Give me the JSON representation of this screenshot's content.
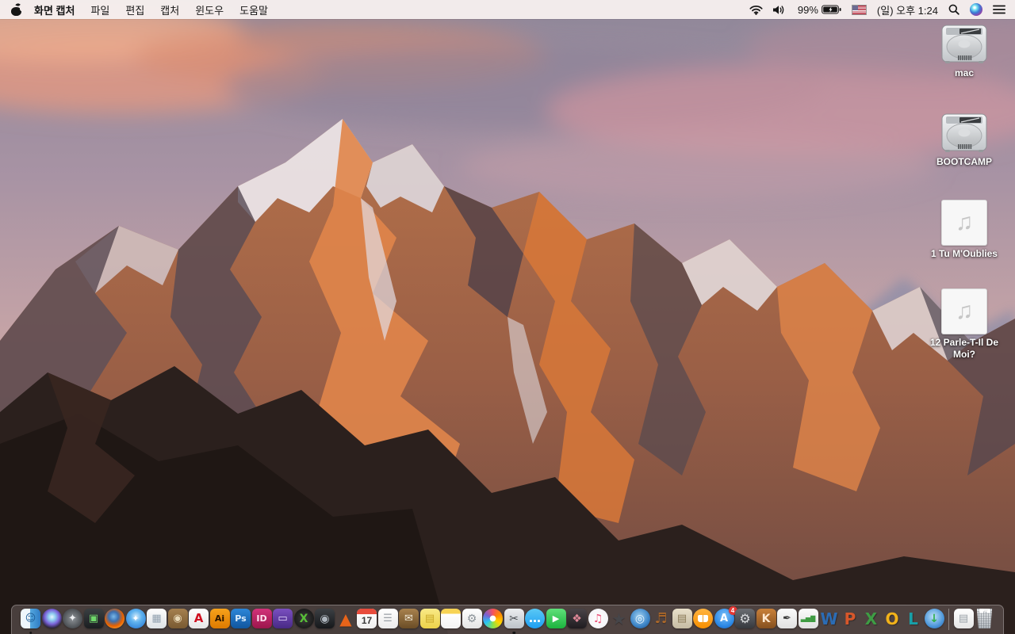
{
  "menu_bar": {
    "app_name": "화면 캡처",
    "menus": [
      "파일",
      "편집",
      "캡처",
      "윈도우",
      "도움말"
    ],
    "battery_percent": "99%",
    "battery_state": "charging",
    "clock": "(일) 오후 1:24",
    "status_icons": [
      "wifi-icon",
      "volume-icon",
      "battery-icon",
      "us-flag-input-source",
      "spotlight-icon",
      "siri-icon",
      "notification-center-icon"
    ]
  },
  "desktop": {
    "icons": [
      {
        "label": "mac",
        "type": "hard-drive"
      },
      {
        "label": "BOOTCAMP",
        "type": "hard-drive"
      },
      {
        "label": "1 Tu M'Oublies",
        "type": "audio-file"
      },
      {
        "label": "12 Parle-T-Il De Moi?",
        "type": "audio-file"
      }
    ]
  },
  "dock": {
    "apps": [
      {
        "name": "finder",
        "glyph": "☺",
        "bg": "linear-gradient(90deg,#eef6fc 0%,#eef6fc 48%,#54a8e0 48%,#2f7cc4 100%)",
        "fg": "#1d5c96",
        "shape": "square",
        "running": true
      },
      {
        "name": "siri",
        "glyph": "",
        "bg": "radial-gradient(circle at 50% 42%,#e8f4ff 0%,#8fd0f0 22%,#7a62d8 48%,#2a2438 74%,#121018 100%)",
        "fg": "#ffffff",
        "shape": "circle"
      },
      {
        "name": "launchpad",
        "glyph": "✦",
        "bg": "radial-gradient(circle,#8f9499 0%,#4a4e52 70%,#2e3134 100%)",
        "fg": "#eceef0",
        "shape": "circle"
      },
      {
        "name": "display-utility",
        "glyph": "▣",
        "bg": "linear-gradient(180deg,#3a3f42,#1b1e21)",
        "fg": "#6fd86a",
        "shape": "square"
      },
      {
        "name": "firefox",
        "glyph": "",
        "bg": "radial-gradient(circle at 45% 40%,#7ab8e8 0%,#3b6fb0 30%,#e66000 58%,#f79b2e 82%,#c84a00 100%)",
        "fg": "#ffffff",
        "shape": "circle"
      },
      {
        "name": "safari",
        "glyph": "✦",
        "bg": "radial-gradient(circle at 50% 40%,#cfe9fa 0%,#5fb2ee 38%,#1e6fd0 100%)",
        "fg": "#ffffff",
        "shape": "circle",
        "fs": 11
      },
      {
        "name": "preview",
        "glyph": "▦",
        "bg": "linear-gradient(180deg,#fdfdfd,#dde2e6)",
        "fg": "#93a2b0",
        "shape": "square"
      },
      {
        "name": "contacts",
        "glyph": "◉",
        "bg": "linear-gradient(180deg,#a5804f,#795a32)",
        "fg": "#e8d9b8",
        "shape": "square"
      },
      {
        "name": "acrobat-reader",
        "glyph": "A",
        "bg": "linear-gradient(180deg,#ffffff,#e6e6e6)",
        "fg": "#cf1020",
        "shape": "square",
        "fs": 15
      },
      {
        "name": "illustrator",
        "glyph": "Ai",
        "bg": "linear-gradient(180deg,#f7a21b,#dd7a00)",
        "fg": "#2a1500",
        "shape": "square",
        "fs": 11
      },
      {
        "name": "photoshop",
        "glyph": "Ps",
        "bg": "linear-gradient(180deg,#2c86d8,#11569e)",
        "fg": "#dff0ff",
        "shape": "square",
        "fs": 11
      },
      {
        "name": "indesign",
        "glyph": "ID",
        "bg": "linear-gradient(180deg,#d2327a,#9c164c)",
        "fg": "#ffe2f0",
        "shape": "square",
        "fs": 11
      },
      {
        "name": "toast-titanium",
        "glyph": "▭",
        "bg": "linear-gradient(180deg,#7a4fc0,#482a85)",
        "fg": "#e6d8ff",
        "shape": "square"
      },
      {
        "name": "video-converter",
        "glyph": "X",
        "bg": "radial-gradient(circle,#3c3c3c 0%,#0e0e0e 100%)",
        "fg": "#58c038",
        "shape": "circle",
        "fs": 14
      },
      {
        "name": "disk-drive-utility",
        "glyph": "◉",
        "bg": "linear-gradient(180deg,#3c4044,#16181b)",
        "fg": "#aeb6be",
        "shape": "square",
        "fs": 14
      },
      {
        "name": "vlc",
        "glyph": "▲",
        "bg": "transparent",
        "fg": "#e8641a",
        "shape": "plain"
      },
      {
        "name": "calendar",
        "bg": "linear-gradient(180deg,#ffffff,#efefef)",
        "shape": "calendar",
        "day": "17"
      },
      {
        "name": "reminders",
        "glyph": "☰",
        "bg": "linear-gradient(180deg,#ffffff,#ebebeb)",
        "fg": "#9aa0a6",
        "shape": "square"
      },
      {
        "name": "wooden-crate-mail",
        "glyph": "✉",
        "bg": "linear-gradient(180deg,#a8824e,#6b4d26)",
        "fg": "#f2ead8",
        "shape": "square"
      },
      {
        "name": "stickies",
        "glyph": "▤",
        "bg": "linear-gradient(180deg,#f9e986,#ecd34a)",
        "fg": "#c9a82a",
        "shape": "square"
      },
      {
        "name": "notes",
        "glyph": "",
        "bg": "linear-gradient(180deg,#f7d354 0%,#f7d354 26%,#ffffff 26%,#f2f2f2 100%)",
        "fg": "#cccccc",
        "shape": "square"
      },
      {
        "name": "photo-settings-utility",
        "glyph": "⚙",
        "bg": "linear-gradient(180deg,#ffffff,#e4e4e4)",
        "fg": "#8a9298",
        "shape": "square",
        "fs": 14
      },
      {
        "name": "photos",
        "glyph": "",
        "bg": "radial-gradient(circle,#ffffff 0 21%,rgba(255,255,255,0) 22%),conic-gradient(from 0deg,#f5515f,#ff8a00,#ffd400,#8ae24a,#27c4f5,#7a5fd0,#f5515f)",
        "fg": "#ffffff",
        "shape": "circle"
      },
      {
        "name": "grab-screen-capture",
        "glyph": "✂",
        "bg": "linear-gradient(180deg,#eceef0,#bcc2c8)",
        "fg": "#46494d",
        "shape": "square",
        "running": true,
        "fs": 14
      },
      {
        "name": "messages",
        "glyph": "…",
        "bg": "linear-gradient(180deg,#5ac8f5,#1d9ff2)",
        "fg": "#ffffff",
        "shape": "circle",
        "fs": 15
      },
      {
        "name": "facetime",
        "glyph": "▶",
        "bg": "linear-gradient(180deg,#5fe07a,#1cb33e)",
        "fg": "#ffffff",
        "shape": "square",
        "fs": 11
      },
      {
        "name": "photo-booth",
        "glyph": "❖",
        "bg": "linear-gradient(180deg,#4a4448,#201c20)",
        "fg": "#e08898",
        "shape": "square",
        "fs": 14
      },
      {
        "name": "itunes",
        "glyph": "♫",
        "bg": "radial-gradient(circle,#ffffff 0%,#f0f0f5 100%)",
        "fg": "#e94f77",
        "shape": "circle",
        "fs": 14
      },
      {
        "name": "imovie",
        "glyph": "★",
        "bg": "transparent",
        "fg": "#46464a",
        "shape": "plain"
      },
      {
        "name": "idvd",
        "glyph": "◎",
        "bg": "radial-gradient(circle at 45% 40%,#9fd0f0 0%,#3e86c8 58%,#184a85 100%)",
        "fg": "#eaf4fc",
        "shape": "circle",
        "fs": 14
      },
      {
        "name": "garageband",
        "glyph": "♬",
        "bg": "transparent",
        "fg": "#b06a28",
        "shape": "plain",
        "fs": 18
      },
      {
        "name": "collage-templates",
        "glyph": "▤",
        "bg": "linear-gradient(180deg,#e9e0ca,#c6bca4)",
        "fg": "#8a7a58",
        "shape": "square"
      },
      {
        "name": "ibooks",
        "glyph": "",
        "bg": "linear-gradient(180deg,#ffb340,#f78f00)",
        "fg": "#ffffff",
        "shape": "circle",
        "overlay": "book"
      },
      {
        "name": "app-store",
        "glyph": "A",
        "bg": "radial-gradient(circle at 50% 35%,#7cc0f8 0%,#2e8ae6 62%,#1560ba 100%)",
        "fg": "#ffffff",
        "shape": "circle",
        "fs": 13,
        "badge": "4"
      },
      {
        "name": "system-preferences",
        "glyph": "⚙",
        "bg": "linear-gradient(180deg,#6a6d72,#36393e)",
        "fg": "#d8dadc",
        "shape": "square",
        "fs": 16
      },
      {
        "name": "keynote",
        "glyph": "K",
        "bg": "linear-gradient(180deg,#c9813a,#85501f)",
        "fg": "#ffe8d0",
        "shape": "square",
        "fs": 14
      },
      {
        "name": "pages",
        "glyph": "✒",
        "bg": "linear-gradient(180deg,#fbfbfb,#e0e0e0)",
        "fg": "#3a3a3a",
        "shape": "square",
        "fs": 13
      },
      {
        "name": "numbers",
        "glyph": "▃▅▇",
        "bg": "linear-gradient(180deg,#fbfbfb,#e0e0e0)",
        "fg": "#3f9b42",
        "shape": "square",
        "fs": 8
      },
      {
        "name": "word",
        "glyph": "W",
        "bg": "transparent",
        "fg": "#2b6cb5",
        "shape": "letter"
      },
      {
        "name": "powerpoint",
        "glyph": "P",
        "bg": "transparent",
        "fg": "#d8572a",
        "shape": "letter"
      },
      {
        "name": "excel",
        "glyph": "X",
        "bg": "transparent",
        "fg": "#3e9c44",
        "shape": "letter"
      },
      {
        "name": "outlook",
        "glyph": "O",
        "bg": "transparent",
        "fg": "#f2b21a",
        "shape": "letter"
      },
      {
        "name": "lync",
        "glyph": "L",
        "bg": "transparent",
        "fg": "#18a0a8",
        "shape": "letter"
      },
      {
        "name": "download-manager",
        "glyph": "↓",
        "bg": "radial-gradient(circle at 45% 40%,#bfe2f8 0%,#4a94d8 62%,#285fa0 100%)",
        "fg": "#2fae4a",
        "shape": "circle",
        "fs": 14
      }
    ],
    "files": [
      {
        "name": "document-file",
        "glyph": "▤",
        "bg": "linear-gradient(180deg,#ffffff,#e6e6e6)",
        "fg": "#9aa2a8",
        "shape": "square"
      }
    ],
    "trash": {
      "name": "trash",
      "state": "full"
    }
  },
  "colors": {
    "menu_bar_bg": "#f6efee",
    "dock_bg": "rgba(112,98,98,0.52)",
    "badge_red": "#e53935",
    "calendar_red": "#e84c3c"
  }
}
